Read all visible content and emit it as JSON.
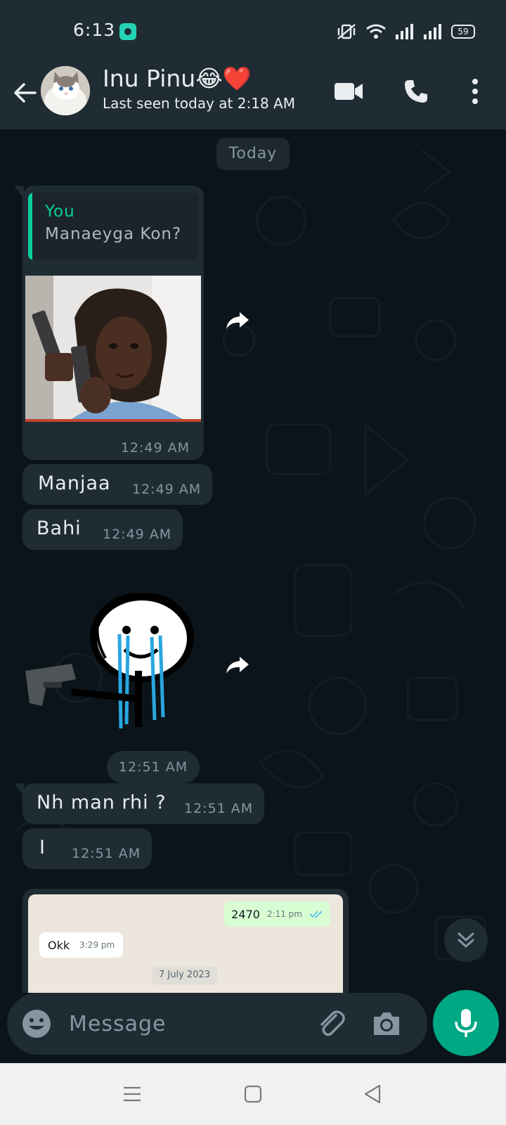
{
  "status_bar": {
    "time": "6:13",
    "battery": "59",
    "icons": [
      "app-notification-icon",
      "vibrate-icon",
      "wifi-icon",
      "signal-icon",
      "signal-icon",
      "battery-icon"
    ]
  },
  "header": {
    "contact_name": "Inu Pinu😂❤️",
    "last_seen": "Last seen today at 2:18 AM",
    "icons": [
      "back-arrow-icon",
      "video-call-icon",
      "voice-call-icon",
      "more-options-icon"
    ]
  },
  "chat": {
    "date_chip": "Today",
    "messages": [
      {
        "type": "image_reply",
        "quote_author": "You",
        "quote_text": "Manaeyga Kon?",
        "time": "12:49 AM"
      },
      {
        "type": "text",
        "text": "Manjaa",
        "time": "12:49 AM"
      },
      {
        "type": "text",
        "text": "Bahi",
        "time": "12:49 AM"
      },
      {
        "type": "sticker",
        "time": "12:51 AM"
      },
      {
        "type": "text",
        "text": "Nh man rhi ?",
        "time": "12:51 AM"
      },
      {
        "type": "text",
        "text": "I",
        "time": "12:51 AM"
      },
      {
        "type": "screenshot",
        "outgoing_text": "2470",
        "outgoing_time": "2:11 pm",
        "incoming_text": "Okk",
        "incoming_time": "3:29 pm",
        "date_label": "7 July 2023"
      }
    ]
  },
  "input_bar": {
    "placeholder": "Message",
    "icons": [
      "emoji-icon",
      "attach-icon",
      "camera-icon",
      "mic-icon"
    ]
  },
  "nav_bar": {
    "icons": [
      "recent-apps-icon",
      "home-icon",
      "back-icon"
    ]
  },
  "colors": {
    "background": "#0b141a",
    "bubble": "#1f2c34",
    "accent": "#00a884",
    "quote_accent": "#06cf9c",
    "secondary_text": "#8696a0"
  }
}
